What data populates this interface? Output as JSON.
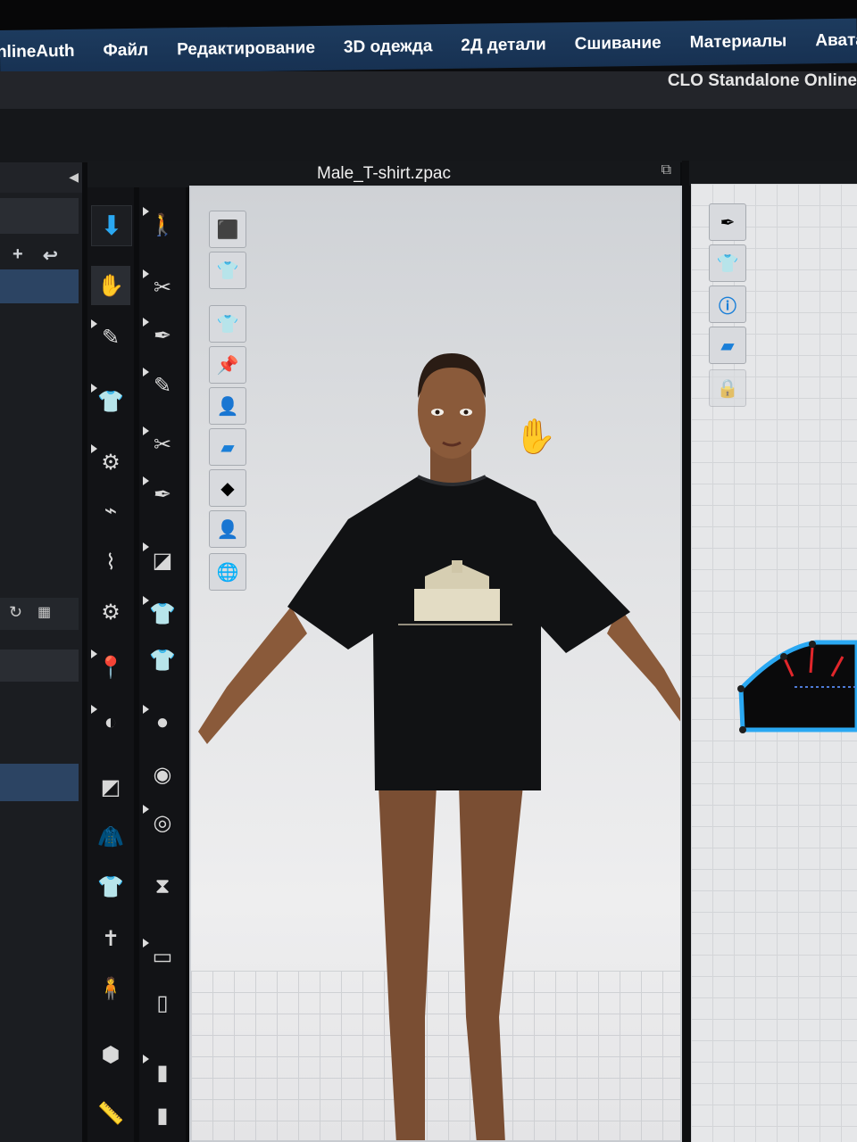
{
  "menu": {
    "app": "nlineAuth",
    "items": [
      "Файл",
      "Редактирование",
      "3D одежда",
      "2Д детали",
      "Сшивание",
      "Материалы",
      "Аватар"
    ]
  },
  "window_title": "CLO Standalone Online",
  "viewport": {
    "file_name": "Male_T-shirt.zpac"
  },
  "left_panel": {
    "add_label": "+",
    "back_label": "↩"
  },
  "icons": {
    "tools_col1": [
      "down-arrow-icon",
      "hand-select-icon",
      "lasso-pen-icon",
      "garment-fit-icon",
      "sewing-machine-icon",
      "sewing-segment-icon",
      "sewing-free-icon",
      "sewing-multi-icon",
      "pin-icon",
      "tack-icon",
      "fold-icon",
      "jacket-icon",
      "tshirt-icon",
      "mannequin-icon",
      "avatar-icon",
      "puzzle-icon",
      "tape-icon"
    ],
    "tools_col2": [
      "walk-icon",
      "edit-curve-icon",
      "pen-icon",
      "knife-icon",
      "cut-icon",
      "sew-icon",
      "graphic-icon",
      "pattern-tshirt-icon",
      "checker-tshirt-icon",
      "button-icon",
      "button-round-icon",
      "buttonhole-icon",
      "zipper-icon",
      "roll-icon",
      "fabric-icon",
      "fabric-flat-icon"
    ],
    "viewport_tools": [
      "cube-icon",
      "tshirt-icon",
      "show-garment-icon",
      "show-pins-icon",
      "show-avatar-icon",
      "texture-icon",
      "shade-icon",
      "avatar-skin-icon",
      "globe-icon"
    ],
    "right_tools": [
      "needle-icon",
      "show-garment-icon",
      "info-icon",
      "texture-icon",
      "lock-garment-icon"
    ]
  },
  "colors": {
    "menubar": "#173152",
    "accent": "#2aa8f2",
    "panel_selected": "#2c4463",
    "shirt": "#111214",
    "skin": "#8a5a3a"
  }
}
